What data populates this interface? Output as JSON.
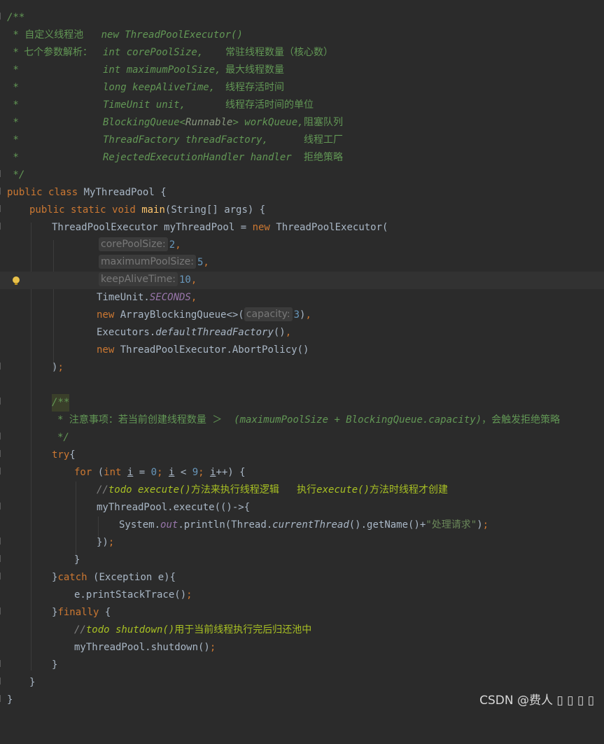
{
  "editor": {
    "doc": {
      "open": "/**",
      "l1_star": " * ",
      "l1_cn": "自定义线程池",
      "l1_code": "new ThreadPoolExecutor()",
      "l2_cn": "七个参数解析：",
      "l2_code": "int corePoolSize,",
      "l2_desc": "常驻线程数量（核心数）",
      "l3_code": "int maximumPoolSize,",
      "l3_desc": "最大线程数量",
      "l4_code": "long keepAliveTime,",
      "l4_desc": "线程存活时间",
      "l5_code": "TimeUnit unit,",
      "l5_desc": "线程存活时间的单位",
      "l6_code_a": "BlockingQueue<",
      "l6_code_b": "Runnable",
      "l6_code_c": "> workQueue,",
      "l6_desc": "阻塞队列",
      "l7_code": "ThreadFactory threadFactory,",
      "l7_desc": "线程工厂",
      "l8_code": "RejectedExecutionHandler handler",
      "l8_desc": "拒绝策略",
      "close": " */"
    },
    "code": {
      "public": "public",
      "class": "class",
      "static": "static",
      "void": "void",
      "new": "new",
      "int": "int",
      "try": "try",
      "for": "for",
      "catch": "catch",
      "finally": "finally",
      "class_name": "MyThreadPool",
      "main": "main",
      "main_args": "(String[] args) {",
      "decl_type": "ThreadPoolExecutor myThreadPool = ",
      "decl_ctor": "ThreadPoolExecutor(",
      "hint_core": "corePoolSize:",
      "val_core": "2",
      "hint_max": "maximumPoolSize:",
      "val_max": "5",
      "hint_keep": "keepAliveTime:",
      "val_keep": "10",
      "timeunit": "TimeUnit.",
      "seconds": "SECONDS",
      "abq": "ArrayBlockingQueue<>(",
      "hint_cap": "capacity:",
      "val_cap": "3",
      "executors": "Executors.",
      "default_factory": "defaultThreadFactory",
      "abort": "ThreadPoolExecutor.AbortPolicy()",
      "close_paren": ")",
      "doc2_open": "/**",
      "doc2_cn": "注意事项：若当前创建线程数量 ＞ ",
      "doc2_code": "(maximumPoolSize + BlockingQueue.capacity)",
      "doc2_cn2": "，会触发拒绝策略",
      "doc2_close": "*/",
      "for_a": "(",
      "for_i": "i",
      "for_b": " = ",
      "zero": "0",
      "for_c": " < ",
      "nine": "9",
      "for_d": "++) {",
      "todo1_a": "todo execute()",
      "todo1_b": "方法来执行线程逻辑   执行",
      "todo1_c": "execute()",
      "todo1_d": "方法时线程才创建",
      "exec_call": "myThreadPool.execute(()->{",
      "println_a": "System.",
      "out": "out",
      "println_b": ".println(Thread.",
      "current_thread": "currentThread",
      "println_c": "().getName()+",
      "str": "\"处理请求\"",
      "lambda_close": "})",
      "catch_args": " (Exception e){",
      "print_stack": "e.printStackTrace()",
      "todo2_a": "todo shutdown()",
      "todo2_b": "用于当前线程执行完后归还池中",
      "shutdown_call": "myThreadPool.shutdown()"
    }
  },
  "watermark": "CSDN @费人 ▯ ▯ ▯ ▯"
}
